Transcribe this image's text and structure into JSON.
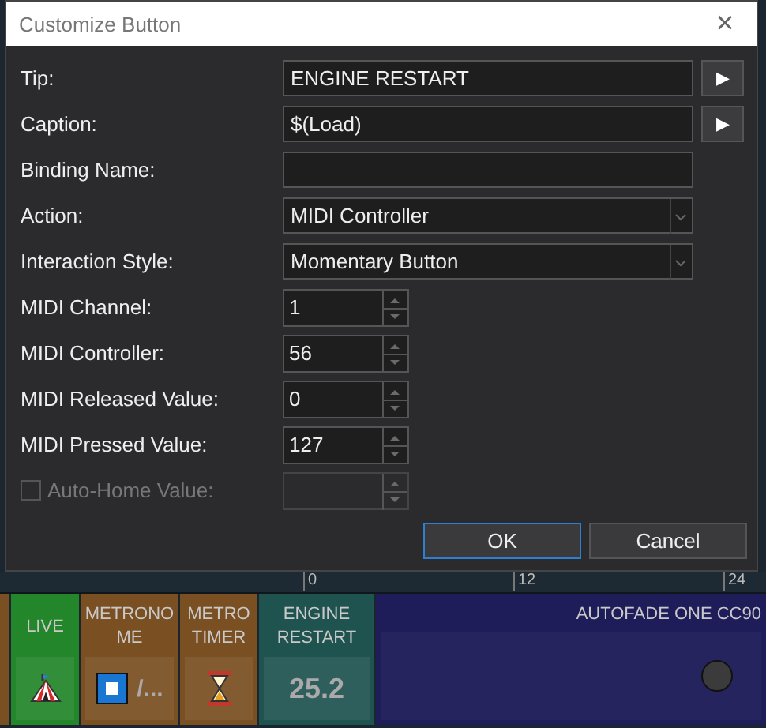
{
  "dialog": {
    "title": "Customize Button",
    "close": "×",
    "fields": [
      {
        "kind": "text-button",
        "label": "Tip:",
        "value": "ENGINE RESTART",
        "button": "▶"
      },
      {
        "kind": "text-button",
        "label": "Caption:",
        "value": "$(Load)",
        "button": "▶"
      },
      {
        "kind": "text",
        "label": "Binding Name:"
      },
      {
        "kind": "dropdown",
        "label": "Action:",
        "value": "MIDI Controller"
      },
      {
        "kind": "dropdown",
        "label": "Interaction Style:",
        "value": "Momentary Button"
      },
      {
        "kind": "spinner",
        "label": "MIDI Channel:",
        "value": "1"
      },
      {
        "kind": "spinner",
        "label": "MIDI Controller:",
        "value": "56"
      },
      {
        "kind": "spinner",
        "label": "MIDI Released Value:",
        "value": "0"
      },
      {
        "kind": "spinner",
        "label": "MIDI Pressed Value:",
        "value": "127"
      },
      {
        "kind": "check-spinner",
        "label": "Auto-Home Value:",
        "checked": false,
        "disabled": true
      }
    ],
    "buttons": [
      {
        "label": "OK",
        "selected": true
      },
      {
        "label": "Cancel",
        "selected": false
      }
    ]
  },
  "ruler": {
    "ticks": [
      "0",
      "12",
      "24"
    ]
  },
  "tiles": [
    {
      "kind": "edge",
      "color": "#7a4f21"
    },
    {
      "kind": "tent",
      "title": "LIVE",
      "color": "#23862a"
    },
    {
      "kind": "stop",
      "title": "METRONO ME",
      "value": "/...",
      "color": "#7a4f21"
    },
    {
      "kind": "hourglass",
      "title": "METRO TIMER",
      "color": "#7a4f21"
    },
    {
      "kind": "value",
      "title": "ENGINE RESTART",
      "value": "25.2",
      "color": "#1f5350"
    },
    {
      "kind": "fader",
      "title": "AUTOFADE ONE CC90",
      "color": "#1e1d5a"
    }
  ]
}
